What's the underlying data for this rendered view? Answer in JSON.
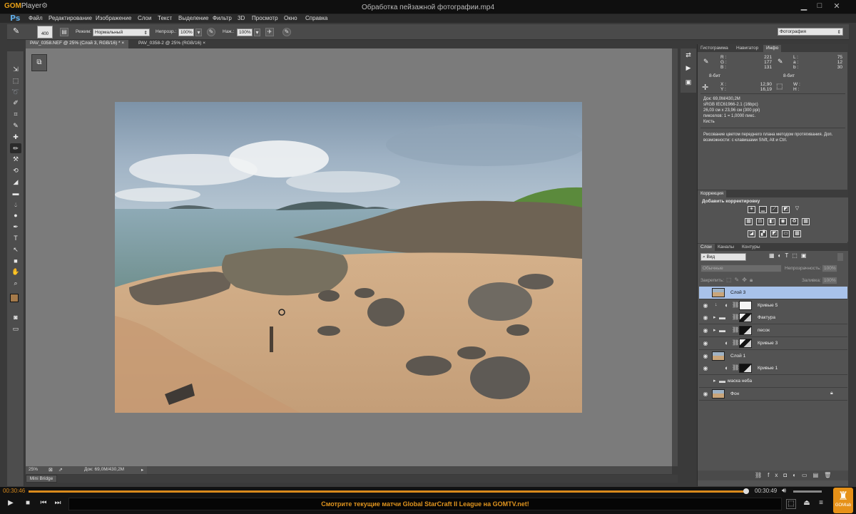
{
  "player": {
    "logo_main": "GOM",
    "logo_sub": "Player",
    "video_title": "Обработка пейзажной фотографии.mp4",
    "time_current": "00:30:46",
    "time_total": "00:30:49",
    "progress_fraction": 0.996,
    "ticker": "Смотрите текущие матчи Global StarCraft II League на GOMTV.net!",
    "gomlab_label": "GOMlab",
    "accent_color": "#d98a1c",
    "icons": [
      "settings-icon",
      "minimize-icon",
      "restore-icon",
      "close-icon",
      "play-icon",
      "stop-icon",
      "prev-icon",
      "next-icon",
      "volume-icon",
      "playlist-icon",
      "eject-icon",
      "menu-icon"
    ]
  },
  "ps": {
    "logo": "Ps",
    "menu": [
      "Файл",
      "Редактирование",
      "Изображение",
      "Слои",
      "Текст",
      "Выделение",
      "Фильтр",
      "3D",
      "Просмотр",
      "Окно",
      "Справка"
    ],
    "options": {
      "brush_size": "400",
      "mode_label": "Режим:",
      "mode_value": "Нормальный",
      "opacity_label": "Непрозр.:",
      "opacity_value": "100%",
      "flow_label": "Наж.:",
      "flow_value": "100%",
      "workspace": "Фотография"
    },
    "doc_tabs": [
      {
        "label": "PAV_0358.NEF @ 25% (Слой 3, RGB/16) *",
        "active": true
      },
      {
        "label": "PAV_0358-2 @ 25% (RGB/16)",
        "active": false
      }
    ],
    "status": {
      "zoom": "25%",
      "doc": "Док: 69,0M/430,2M"
    },
    "mini_bridge": "Mini Bridge",
    "tools": [
      "move-tool",
      "marquee-tool",
      "lasso-tool",
      "quick-select-tool",
      "crop-tool",
      "eyedropper-tool",
      "healing-brush-tool",
      "brush-tool",
      "clone-stamp-tool",
      "history-brush-tool",
      "eraser-tool",
      "gradient-tool",
      "blur-tool",
      "dodge-tool",
      "pen-tool",
      "type-tool",
      "path-select-tool",
      "shape-tool",
      "hand-tool",
      "zoom-tool"
    ],
    "info_panel": {
      "tabs": [
        "Гистограмма",
        "Навигатор",
        "Инфо"
      ],
      "rgb_labels": [
        "R :",
        "G :",
        "B :"
      ],
      "rgb_values": [
        "221",
        "177",
        "131"
      ],
      "lab_labels": [
        "L :",
        "a :",
        "b :"
      ],
      "lab_values": [
        "75",
        "12",
        "30"
      ],
      "bit_left": "8-бит",
      "bit_right": "8-бит",
      "x_label": "X :",
      "x_value": "12,90",
      "y_label": "Y :",
      "y_value": "16,19",
      "w_label": "W :",
      "h_label": "H :",
      "doc_lines": [
        "Док: 69,0M/430,2M",
        "sRGB IEC61966-2.1 (16bpc)",
        "26,03 см x 23,96 см (300 ppi)",
        "пикселов: 1 = 1,0000 пикс.",
        "Кисть"
      ],
      "hint": [
        "Рисование цветом переднего плана методом протягивания. Доп.",
        "возможности: с клавишами Shift, Alt и Ctrl."
      ]
    },
    "adjust_panel": {
      "tab": "Коррекция",
      "title": "Добавить корректировку"
    },
    "layers_panel": {
      "tabs": [
        "Слои",
        "Каналы",
        "Контуры"
      ],
      "filter": "Вид",
      "blend": "Обычные",
      "opacity_label": "Непрозрачность:",
      "opacity_value": "100%",
      "lock_label": "Закрепить:",
      "fill_label": "Заливка:",
      "fill_value": "100%",
      "layers": [
        {
          "name": "Слой 3",
          "selected": true,
          "visible": false,
          "group": false,
          "adj": false,
          "mask": false,
          "thumb": "photo"
        },
        {
          "name": "Кривые 5",
          "selected": false,
          "visible": true,
          "group": false,
          "adj": true,
          "mask": "white",
          "clip": true
        },
        {
          "name": "Фактура",
          "selected": false,
          "visible": true,
          "group": true,
          "adj": false,
          "mask": "mixed"
        },
        {
          "name": "песок",
          "selected": false,
          "visible": true,
          "group": true,
          "adj": false,
          "mask": "dark"
        },
        {
          "name": "Кривые 3",
          "selected": false,
          "visible": true,
          "group": false,
          "adj": true,
          "mask": "mixed"
        },
        {
          "name": "Слой 1",
          "selected": false,
          "visible": true,
          "group": false,
          "adj": false,
          "mask": false,
          "thumb": "photo"
        },
        {
          "name": "Кривые 1",
          "selected": false,
          "visible": true,
          "group": false,
          "adj": true,
          "mask": "dark"
        },
        {
          "name": "маска неба",
          "selected": false,
          "visible": false,
          "group": true,
          "adj": false,
          "mask": false
        },
        {
          "name": "Фон",
          "selected": false,
          "visible": true,
          "group": false,
          "adj": false,
          "mask": false,
          "thumb": "photo",
          "locked": true
        }
      ]
    }
  }
}
